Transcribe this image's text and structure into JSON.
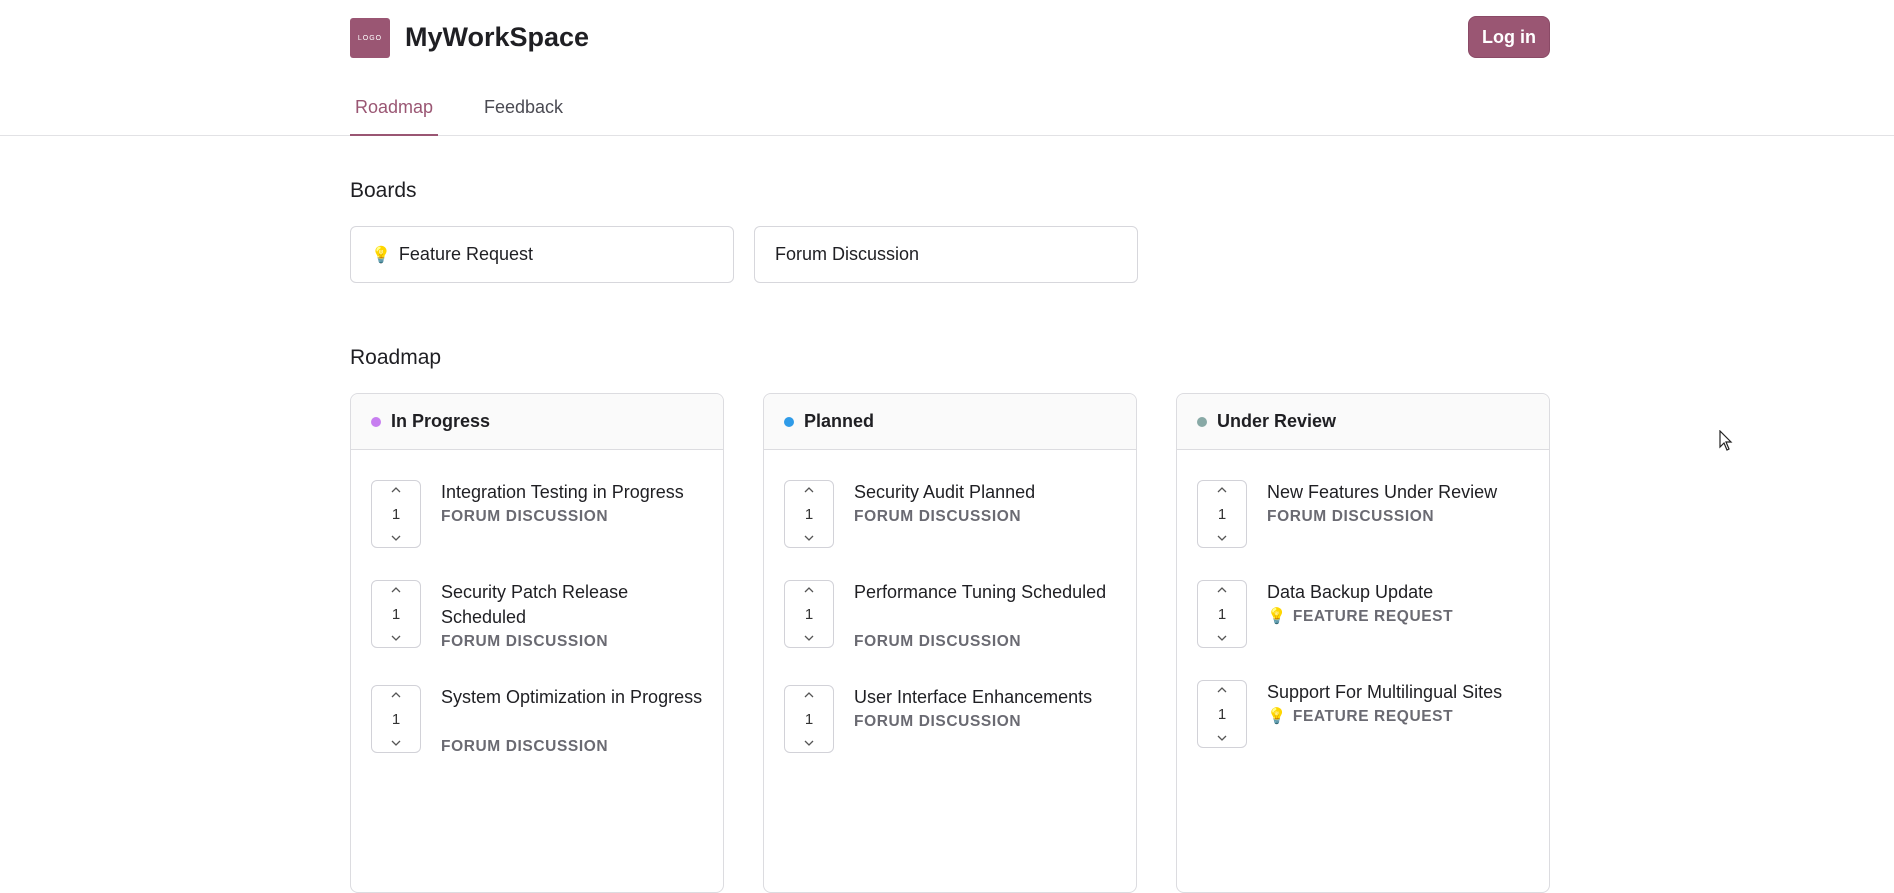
{
  "header": {
    "logo_text": "LOGO",
    "app_title": "MyWorkSpace",
    "login_label": "Log in"
  },
  "nav": {
    "tabs": [
      {
        "label": "Roadmap",
        "active": true
      },
      {
        "label": "Feedback",
        "active": false
      }
    ]
  },
  "boards": {
    "title": "Boards",
    "items": [
      {
        "label": "Feature Request",
        "icon": "lightbulb-icon"
      },
      {
        "label": "Forum Discussion",
        "icon": ""
      }
    ]
  },
  "roadmap": {
    "title": "Roadmap",
    "columns": [
      {
        "name": "In Progress",
        "dot_color": "#c77ef0",
        "items": [
          {
            "title": "Integration Testing in Progress",
            "votes": "1",
            "tag": "FORUM DISCUSSION"
          },
          {
            "title": "Security Patch Release Scheduled",
            "votes": "1",
            "tag": "FORUM DISCUSSION"
          },
          {
            "title": "System Optimization in Progress",
            "votes": "1",
            "tag": "FORUM DISCUSSION"
          }
        ]
      },
      {
        "name": "Planned",
        "dot_color": "#2f9be8",
        "items": [
          {
            "title": "Security Audit Planned",
            "votes": "1",
            "tag": "FORUM DISCUSSION"
          },
          {
            "title": "Performance Tuning Scheduled",
            "votes": "1",
            "tag": "FORUM DISCUSSION"
          },
          {
            "title": "User Interface Enhancements",
            "votes": "1",
            "tag": "FORUM DISCUSSION"
          }
        ]
      },
      {
        "name": "Under Review",
        "dot_color": "#88a9a6",
        "items": [
          {
            "title": "New Features Under Review",
            "votes": "1",
            "tag": "FORUM DISCUSSION"
          },
          {
            "title": "Data Backup Update",
            "votes": "1",
            "tag": "FEATURE REQUEST"
          },
          {
            "title": "Support For Multilingual Sites",
            "votes": "1",
            "tag": "FEATURE REQUEST"
          }
        ]
      }
    ]
  },
  "colors": {
    "brand": "#9a5673",
    "border": "#dcdce0"
  }
}
